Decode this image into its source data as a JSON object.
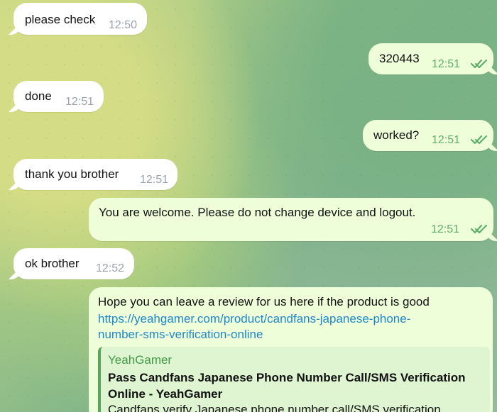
{
  "messages": [
    {
      "text": "please check",
      "time": "12:50"
    },
    {
      "text": "320443",
      "time": "12:51"
    },
    {
      "text": "done",
      "time": "12:51"
    },
    {
      "text": "worked?",
      "time": "12:51"
    },
    {
      "text": "thank you brother",
      "time": "12:51"
    },
    {
      "text": "You are welcome. Please do not change device and logout.",
      "time": "12:51"
    },
    {
      "text": "ok brother",
      "time": "12:52"
    },
    {
      "text": "Hope you can leave a review for us here if the product is good",
      "link": "https://yeahgamer.com/product/candfans-japanese-phone-number-sms-verification-online",
      "link_line_1": "https://yeahgamer.com/product/candfans-japanese-phone-",
      "link_line_2": "number-sms-verification-online",
      "preview": {
        "site": "YeahGamer",
        "title": "Pass Candfans Japanese Phone Number Call/SMS Verification Online - YeahGamer",
        "title_line_1": "Pass Candfans Japanese Phone Number Call/SMS Verification",
        "title_line_2": "Online - YeahGamer",
        "description": "Candfans verify Japanese phone number call/SMS verification"
      }
    }
  ],
  "colors": {
    "incoming_bubble": "#ffffff",
    "outgoing_bubble": "#eefed9",
    "link": "#1f87c7",
    "read_ticks": "#5fae6b",
    "preview_accent": "#5aa45c"
  },
  "icons": {
    "read_status": "double-check-icon"
  }
}
